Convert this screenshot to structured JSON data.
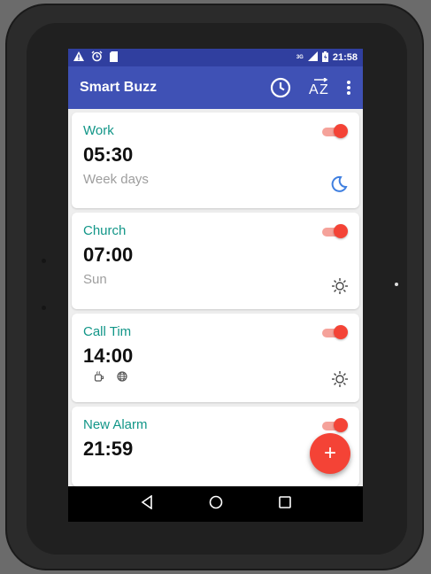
{
  "status_bar": {
    "time": "21:58",
    "network": "3G",
    "left_icons": [
      "warning-icon",
      "alarm-clock-icon",
      "sd-card-icon"
    ]
  },
  "app_bar": {
    "title": "Smart Buzz",
    "actions": [
      "clock-icon",
      "sort-az-icon",
      "more-vert-icon"
    ],
    "color": "#3f51b5",
    "status_color": "#303f9f"
  },
  "alarms": [
    {
      "name": "Work",
      "time": "05:30",
      "days": "Week days",
      "enabled": true,
      "type_icon": "moon-icon"
    },
    {
      "name": "Church",
      "time": "07:00",
      "days": "Sun",
      "enabled": true,
      "type_icon": "sun-icon"
    },
    {
      "name": "Call Tim",
      "time": "14:00",
      "days": "",
      "enabled": true,
      "type_icon": "sun-icon",
      "extra_icons": [
        "coffee-icon",
        "globe-icon"
      ]
    },
    {
      "name": "New Alarm",
      "time": "21:59",
      "days": "",
      "enabled": true
    }
  ],
  "fab": {
    "label": "+",
    "color": "#f44336"
  },
  "nav_bar": [
    "back-icon",
    "home-icon",
    "recents-icon"
  ],
  "accent": {
    "teal": "#129688",
    "red": "#f44336"
  }
}
